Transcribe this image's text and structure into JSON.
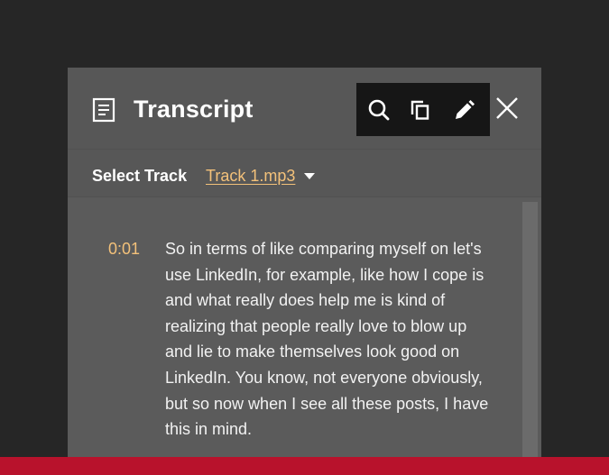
{
  "header": {
    "title": "Transcript",
    "doc_icon": "document-icon",
    "toolbar": [
      {
        "name": "search-icon"
      },
      {
        "name": "copy-icon"
      },
      {
        "name": "edit-icon"
      }
    ],
    "close_icon": "close-icon"
  },
  "track": {
    "label": "Select Track",
    "selected": "Track 1.mp3",
    "dropdown_icon": "caret-down-icon"
  },
  "transcript": {
    "entries": [
      {
        "time": "0:01",
        "text": "So in terms of like comparing myself on let's use LinkedIn, for example, like how I cope is and what really does help me is kind of realizing that people really love to blow up and lie to make themselves look good on LinkedIn. You know, not everyone obviously, but so now when I see all these posts, I have this in mind."
      }
    ]
  },
  "colors": {
    "background": "#262626",
    "panel": "#5b5b5b",
    "accent": "#f3c17a",
    "toolbar": "#161616",
    "bottom_bar": "#b8122c"
  }
}
